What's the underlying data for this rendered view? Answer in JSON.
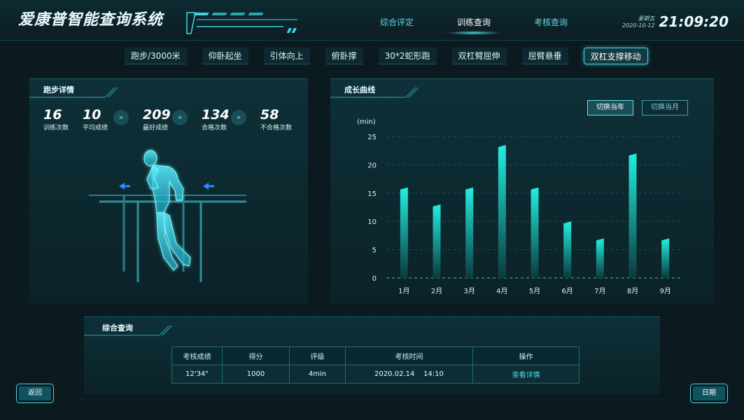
{
  "header": {
    "title": "爱康普智能查询系统",
    "nav": [
      "综合评定",
      "训练查询",
      "考核查询"
    ],
    "active_nav": 1,
    "weekday": "星期五",
    "date": "2020-10-12",
    "time": "21:09:20"
  },
  "subtabs": {
    "items": [
      "跑步/3000米",
      "仰卧起坐",
      "引体向上",
      "俯卧撑",
      "30*2蛇形跑",
      "双杠臂屈伸",
      "屈臂悬垂",
      "双杠支撑移动"
    ],
    "active": 7
  },
  "detail_panel": {
    "title": "跑步详情",
    "stats": [
      {
        "value": "16",
        "label": "训练次数"
      },
      {
        "value": "10",
        "label": "平均成绩"
      },
      {
        "value": "209",
        "label": "最好成绩"
      },
      {
        "value": "134",
        "label": "合格次数"
      },
      {
        "value": "58",
        "label": "不合格次数"
      }
    ],
    "arrow_glyph": "»"
  },
  "growth_panel": {
    "title": "成长曲线",
    "btn_year": "切换当年",
    "btn_month": "切换当月"
  },
  "chart_data": {
    "type": "bar",
    "ylabel": "(min)",
    "categories": [
      "1月",
      "2月",
      "3月",
      "4月",
      "5月",
      "6月",
      "7月",
      "8月",
      "9月"
    ],
    "values": [
      16,
      13,
      16,
      23.5,
      16,
      10,
      7,
      22,
      7
    ],
    "ylim": [
      0,
      25
    ],
    "yticks": [
      "0",
      "5",
      "10",
      "15",
      "20",
      "25"
    ],
    "grid": true,
    "colors": {
      "bar_top": "#22f0e0",
      "bar_bottom": "#0b3a3e"
    }
  },
  "query_panel": {
    "title": "综合查询",
    "columns": [
      "考核成绩",
      "得分",
      "评级",
      "考核时间",
      "操作"
    ],
    "rows": [
      {
        "score": "12'34\"",
        "points": "1000",
        "grade": "4min",
        "time": "2020.02.14    14:10",
        "action": "查看详情"
      }
    ]
  },
  "buttons": {
    "back": "返回",
    "date": "日期"
  },
  "colors": {
    "accent": "#49d8e6",
    "background": "#0b1a1f"
  }
}
